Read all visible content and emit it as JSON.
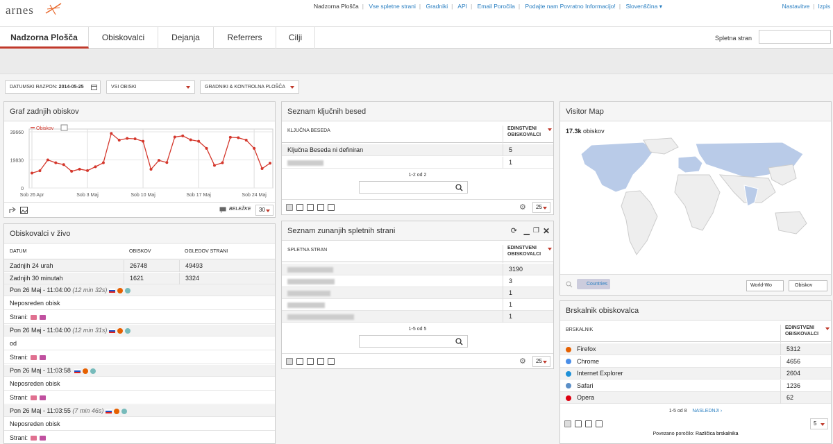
{
  "brand": {
    "logo": "arnes"
  },
  "topnav": {
    "items": [
      "Nadzorna Plošča",
      "Vse spletne strani",
      "Gradniki",
      "API",
      "Email Poročila",
      "Podajte nam Povratno Informacijo!",
      "Slovenščina"
    ],
    "right": [
      "Nastavitve",
      "Izpis"
    ]
  },
  "tabs": [
    "Nadzorna Plošča",
    "Obiskovalci",
    "Dejanja",
    "Referrers",
    "Cilji"
  ],
  "site_label": "Spletna stran",
  "filters": {
    "date_label": "Datumski razpon:",
    "date_value": "2014-05-25",
    "segment": "Vsi obiski",
    "dashboard": "Gradniki & Kontrolna plošča"
  },
  "graph": {
    "title": "Graf zadnjih obiskov",
    "legend": "Obiskov",
    "yticks": [
      "39660",
      "19830",
      "0"
    ],
    "xticks": [
      "Sob 26 Apr",
      "Sob 3 Maj",
      "Sob 10 Maj",
      "Sob 17 Maj",
      "Sob 24 Maj"
    ],
    "notes": "BELEŽKE",
    "limit": "30"
  },
  "chart_data": {
    "type": "line",
    "title": "Graf zadnjih obiskov",
    "series": [
      {
        "name": "Obiskov",
        "values": [
          10500,
          12200,
          19800,
          17800,
          16500,
          11800,
          13300,
          12300,
          15000,
          17800,
          38500,
          33800,
          35000,
          34700,
          33000,
          13200,
          19500,
          18000,
          36000,
          36800,
          34000,
          33000,
          28000,
          16000,
          17800,
          35800,
          35500,
          33800,
          28000,
          13700,
          17500
        ]
      }
    ],
    "ylim": [
      0,
      39660
    ],
    "xticks": [
      "Sob 26 Apr",
      "Sob 3 Maj",
      "Sob 10 Maj",
      "Sob 17 Maj",
      "Sob 24 Maj"
    ]
  },
  "live": {
    "title": "Obiskovalci v živo",
    "cols": [
      "Datum",
      "Obiskov",
      "Ogledov strani"
    ],
    "rows": [
      [
        "Zadnjih 24 urah",
        "26748",
        "49493"
      ],
      [
        "Zadnjih 30 minutah",
        "1621",
        "3324"
      ]
    ],
    "visits": [
      {
        "time": "Pon 26 Maj - 11:04:00",
        "dur": "(12 min 32s)",
        "ref": "Neposreden obisk"
      },
      {
        "time": "Pon 26 Maj - 11:04:00",
        "dur": "(12 min 31s)",
        "ref": "od"
      },
      {
        "time": "Pon 26 Maj - 11:03:58",
        "dur": "",
        "ref": "Neposreden obisk"
      },
      {
        "time": "Pon 26 Maj - 11:03:55",
        "dur": "(7 min 46s)",
        "ref": "Neposreden obisk"
      }
    ],
    "pages_label": "Strani:"
  },
  "keywords": {
    "title": "Seznam ključnih besed",
    "col1": "Ključna beseda",
    "col2": "Edinstveni obiskovalci",
    "rows": [
      {
        "label": "Ključna Beseda ni definiran",
        "value": "5"
      },
      {
        "label": "",
        "value": "1"
      }
    ],
    "pager": "1-2 od 2",
    "limit": "25"
  },
  "sites": {
    "title": "Seznam zunanjih spletnih strani",
    "col1": "Spletna stran",
    "col2": "Edinstveni obiskovalci",
    "values": [
      "3190",
      "3",
      "1",
      "1",
      "1"
    ],
    "pager": "1-5 od 5",
    "limit": "25"
  },
  "map": {
    "title": "Visitor Map",
    "stat": "17.3k",
    "stat_label": "obiskov",
    "button": "Countries",
    "select1": "World-Wo",
    "select2": "Obiskov"
  },
  "browsers": {
    "title": "Brskalnik obiskovalca",
    "col1": "Brskalnik",
    "col2": "Edinstveni obiskovalci",
    "rows": [
      {
        "name": "Firefox",
        "value": "5312"
      },
      {
        "name": "Chrome",
        "value": "4656"
      },
      {
        "name": "Internet Explorer",
        "value": "2604"
      },
      {
        "name": "Safari",
        "value": "1236"
      },
      {
        "name": "Opera",
        "value": "62"
      }
    ],
    "pager": "1-5 od 8",
    "next": "NASLEDNJI ›",
    "limit": "5",
    "related_label": "Povezano poročilo:",
    "related": "Različica brskalnika"
  },
  "colors": {
    "accent": "#c0392b",
    "link": "#2a7fc1",
    "map_active": "#b9cbe8"
  }
}
